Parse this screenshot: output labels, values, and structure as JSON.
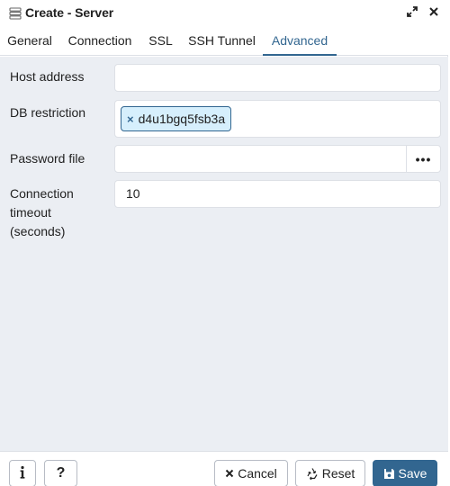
{
  "window": {
    "title": "Create - Server",
    "icons": {
      "app": "server-icon",
      "maximize": "maximize-icon",
      "close": "close-icon"
    }
  },
  "tabs": [
    {
      "label": "General",
      "active": false
    },
    {
      "label": "Connection",
      "active": false
    },
    {
      "label": "SSL",
      "active": false
    },
    {
      "label": "SSH Tunnel",
      "active": false
    },
    {
      "label": "Advanced",
      "active": true
    }
  ],
  "form": {
    "host_address": {
      "label": "Host address",
      "value": ""
    },
    "db_restriction": {
      "label": "DB restriction",
      "tags": [
        {
          "remove": "×",
          "text": "d4u1bgq5fsb3a"
        }
      ]
    },
    "password_file": {
      "label": "Password file",
      "value": "",
      "browse": "•••"
    },
    "connection_timeout": {
      "label": "Connection timeout (seconds)",
      "value": "10"
    }
  },
  "footer": {
    "info_icon": "info-icon",
    "help_label": "?",
    "cancel_label": "Cancel",
    "reset_label": "Reset",
    "save_label": "Save"
  },
  "colors": {
    "accent": "#326690",
    "body_bg": "#ebeef3",
    "tag_bg": "#d6effc",
    "border": "#dde0e6"
  }
}
